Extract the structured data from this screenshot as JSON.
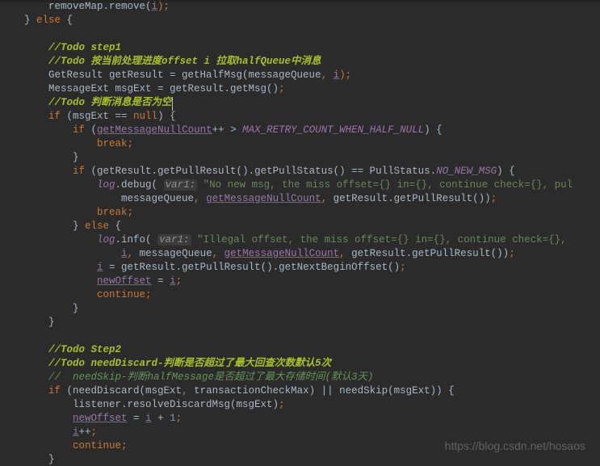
{
  "watermark": "https://blog.csdn.net/hosaos",
  "code": {
    "l01a": "        removeMap.remove(",
    "l01b": "i",
    "l01c": ");",
    "l02a": "    } ",
    "l02b": "else",
    "l02c": " {",
    "l03": "",
    "l04": "        //Todo step1",
    "l05": "        //Todo 按当前处理进度offset i 拉取halfQueue中消息",
    "l06a": "        GetResult getResult = getHalfMsg(messageQueue",
    "l06b": ", ",
    "l06c": "i",
    "l06d": ");",
    "l07a": "        MessageExt msgExt = getResult.getMsg()",
    "l07b": ";",
    "l08": "        //Todo 判断消息是否为空",
    "l09a": "        ",
    "l09b": "if",
    "l09c": " (msgExt == ",
    "l09d": "null",
    "l09e": ") {",
    "l10a": "            ",
    "l10b": "if",
    "l10c": " (",
    "l10d": "getMessageNullCount",
    "l10e": "++ > ",
    "l10f": "MAX_RETRY_COUNT_WHEN_HALF_NULL",
    "l10g": ") {",
    "l11a": "                ",
    "l11b": "break;",
    "l12": "            }",
    "l13a": "            ",
    "l13b": "if",
    "l13c": " (getResult.getPullResult().getPullStatus() == PullStatus.",
    "l13d": "NO_NEW_MSG",
    "l13e": ") {",
    "l14a": "                ",
    "l14b": "log",
    "l14c": ".debug( ",
    "l14d": "var1:",
    "l14e": " \"No new msg, the miss offset={} in={}, continue check={}, pul",
    "l15a": "                    messageQueue",
    "l15b": ", ",
    "l15c": "getMessageNullCount",
    "l15d": ", ",
    "l15e": "getResult.getPullResult())",
    "l15f": ";",
    "l16a": "                ",
    "l16b": "break;",
    "l17a": "            } ",
    "l17b": "else",
    "l17c": " {",
    "l18a": "                ",
    "l18b": "log",
    "l18c": ".info( ",
    "l18d": "var1:",
    "l18e": " \"Illegal offset, the miss offset={} in={}, continue check={},",
    "l19a": "                    ",
    "l19b": "i",
    "l19c": ", ",
    "l19d": "messageQueue",
    "l19e": ", ",
    "l19f": "getMessageNullCount",
    "l19g": ", ",
    "l19h": "getResult.getPullResult())",
    "l19i": ";",
    "l20a": "                ",
    "l20b": "i",
    "l20c": " = getResult.getPullResult().getNextBeginOffset()",
    "l20d": ";",
    "l21a": "                ",
    "l21b": "newOffset",
    "l21c": " = ",
    "l21d": "i",
    "l21e": ";",
    "l22a": "                ",
    "l22b": "continue;",
    "l23": "            }",
    "l24": "        }",
    "l25": "",
    "l26": "        //Todo Step2",
    "l27": "        //Todo needDiscard-判断是否超过了最大回查次数默认5次",
    "l28": "        //  needSkip-判断halfMessage是否超过了最大存储时间(默认3天)",
    "l29a": "        ",
    "l29b": "if",
    "l29c": " (needDiscard(msgExt",
    "l29d": ", ",
    "l29e": "transactionCheckMax) || needSkip(msgExt)) {",
    "l30a": "            listener.resolveDiscardMsg(msgExt)",
    "l30b": ";",
    "l31a": "            ",
    "l31b": "newOffset",
    "l31c": " = ",
    "l31d": "i",
    "l31e": " + ",
    "l31f": "1",
    "l31g": ";",
    "l32a": "            ",
    "l32b": "i",
    "l32c": "++",
    "l32d": ";",
    "l33a": "            ",
    "l33b": "continue;",
    "l34": "        }"
  }
}
